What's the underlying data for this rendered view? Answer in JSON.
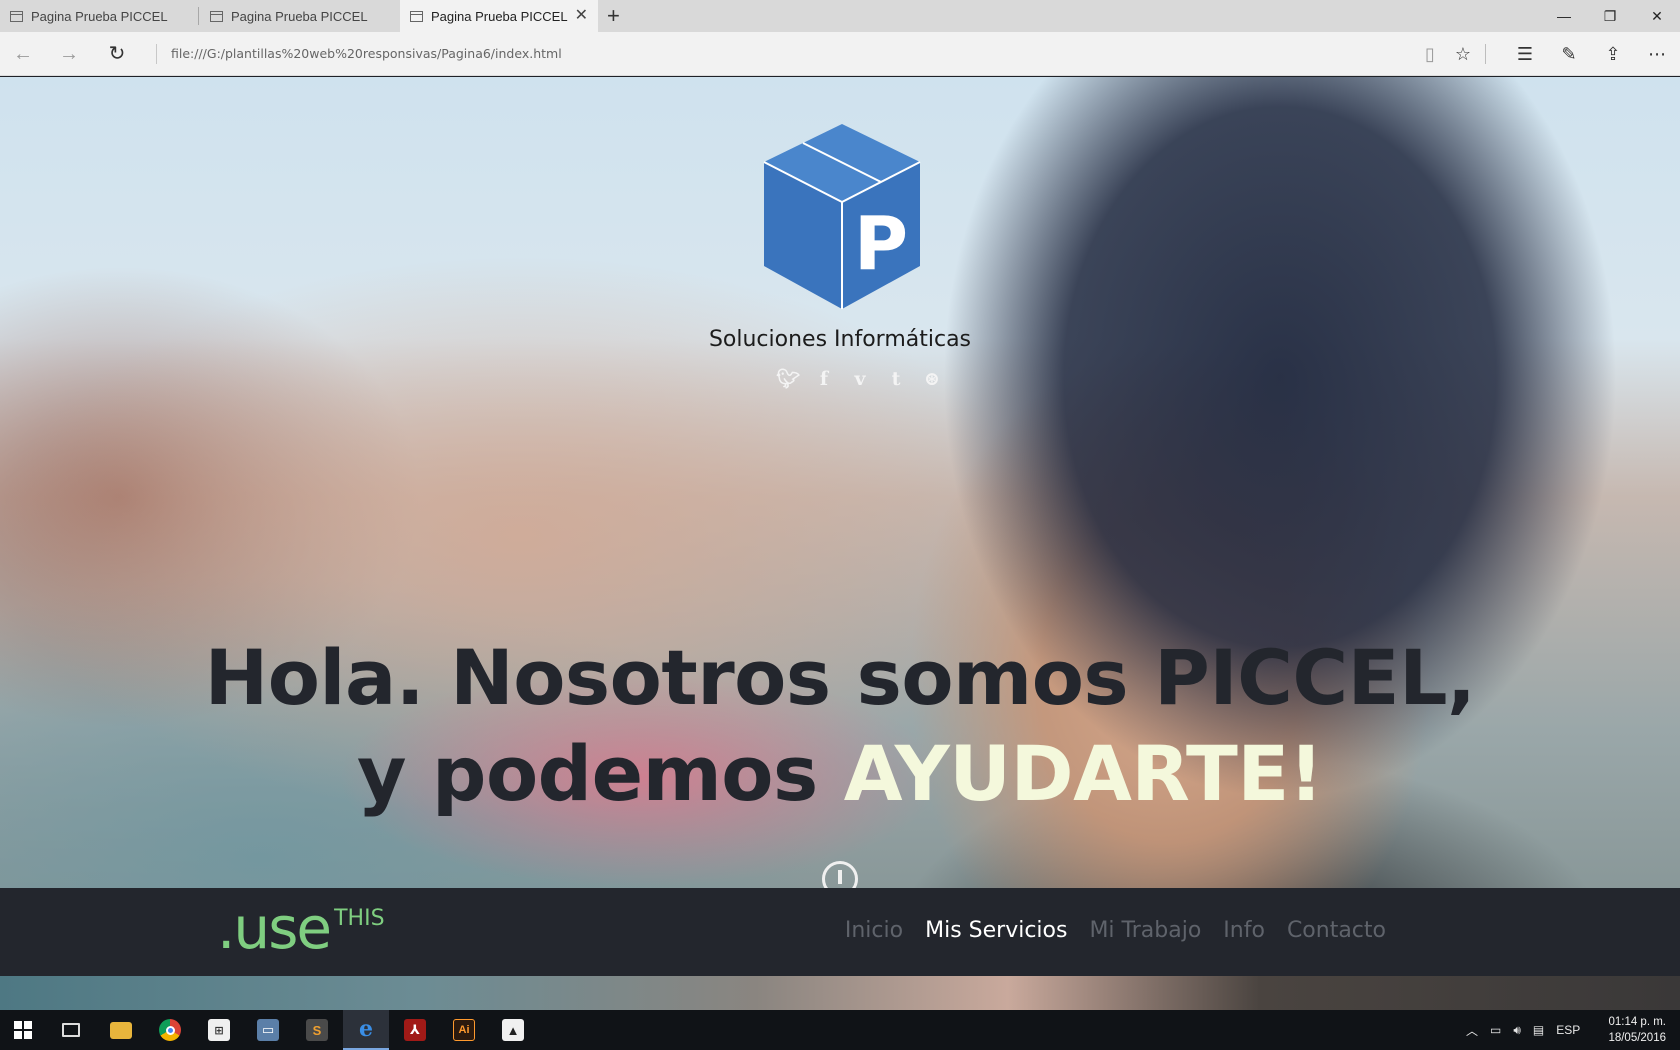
{
  "browser": {
    "tabs": [
      {
        "title": "Pagina Prueba PICCEL",
        "active": false
      },
      {
        "title": "Pagina Prueba PICCEL",
        "active": false
      },
      {
        "title": "Pagina Prueba PICCEL",
        "active": true
      }
    ],
    "url": "file:///G:/plantillas%20web%20responsivas/Pagina6/index.html"
  },
  "hero": {
    "logo_letter": "P",
    "brand": "Soluciones Informáticas",
    "social_icons": [
      "twitter-icon",
      "facebook-icon",
      "vimeo-icon",
      "tumblr-icon",
      "dribbble-icon"
    ],
    "headline_line1": "Hola. Nosotros somos PICCEL,",
    "headline_line2_prefix": "y podemos ",
    "headline_line2_accent": "AYUDARTE!"
  },
  "site_nav": {
    "logo_main": ".use",
    "logo_sup": "THIS",
    "items": [
      {
        "label": "Inicio",
        "active": false
      },
      {
        "label": "Mis Servicios",
        "active": true
      },
      {
        "label": "Mi Trabajo",
        "active": false
      },
      {
        "label": "Info",
        "active": false
      },
      {
        "label": "Contacto",
        "active": false
      }
    ]
  },
  "taskbar": {
    "language": "ESP",
    "time": "01:14 p. m.",
    "date": "18/05/2016",
    "apps": [
      "start",
      "task-view",
      "file-explorer",
      "chrome",
      "store",
      "remote-desktop",
      "sublime-text",
      "edge",
      "acrobat",
      "illustrator",
      "photos"
    ]
  },
  "colors": {
    "accent_green": "#7fce80",
    "logo_blue": "#3a74bd",
    "nav_bg": "#23262d",
    "headline_accent": "#f4f8dc"
  }
}
